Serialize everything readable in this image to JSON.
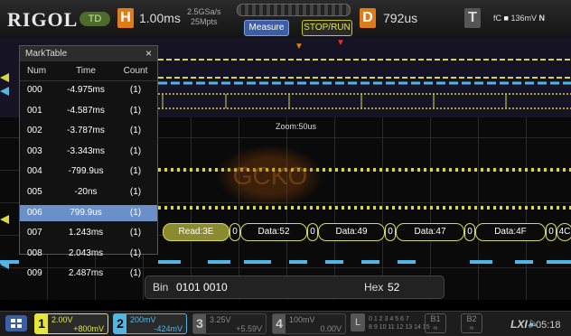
{
  "topbar": {
    "brand": "RIGOL",
    "mode": "TD",
    "horizontal": {
      "letter": "H",
      "timebase": "1.00ms",
      "rate": "2.5GSa/s",
      "depth": "25Mpts"
    },
    "buttons": {
      "measure": "Measure",
      "stoprun": "STOP/RUN"
    },
    "delay": {
      "letter": "D",
      "value": "792us"
    },
    "trigger": {
      "letter": "T",
      "source": "fC",
      "level": "136mV",
      "mode": "N"
    }
  },
  "marktable": {
    "title": "MarkTable",
    "close": "×",
    "columns": {
      "num": "Num",
      "time": "Time",
      "count": "Count"
    },
    "rows": [
      {
        "num": "000",
        "time": "-4.975ms",
        "count": "(1)"
      },
      {
        "num": "001",
        "time": "-4.587ms",
        "count": "(1)"
      },
      {
        "num": "002",
        "time": "-3.787ms",
        "count": "(1)"
      },
      {
        "num": "003",
        "time": "-3.343ms",
        "count": "(1)"
      },
      {
        "num": "004",
        "time": "-799.9us",
        "count": "(1)"
      },
      {
        "num": "005",
        "time": "-20ns",
        "count": "(1)"
      },
      {
        "num": "006",
        "time": "799.9us",
        "count": "(1)",
        "selected": true
      },
      {
        "num": "007",
        "time": "1.243ms",
        "count": "(1)"
      },
      {
        "num": "008",
        "time": "2.043ms",
        "count": "(1)"
      },
      {
        "num": "009",
        "time": "2.487ms",
        "count": "(1)"
      }
    ]
  },
  "zoom_label": "Zoom:50us",
  "decode": {
    "segments": [
      {
        "label": "Read:3E",
        "highlight": true
      },
      {
        "label": "0"
      },
      {
        "label": "Data:52"
      },
      {
        "label": "0"
      },
      {
        "label": "Data:49"
      },
      {
        "label": "0"
      },
      {
        "label": "Data:47"
      },
      {
        "label": "0"
      },
      {
        "label": "Data:4F"
      },
      {
        "label": "0"
      },
      {
        "label": "4C"
      }
    ]
  },
  "bin_hex": {
    "bin_label": "Bin",
    "bin_value": "0101 0010",
    "hex_label": "Hex",
    "hex_value": "52"
  },
  "channels": [
    {
      "num": "1",
      "scale": "2.00V",
      "offset": "+800mV",
      "color": "#e6e63a",
      "active": true
    },
    {
      "num": "2",
      "scale": "200mV",
      "offset": "-424mV",
      "color": "#4fb6e8",
      "active": true
    },
    {
      "num": "3",
      "scale": "3.25V",
      "offset": "+5.59V",
      "color": "#888888",
      "active": false
    },
    {
      "num": "4",
      "scale": "100mV",
      "offset": "0.00V",
      "color": "#888888",
      "active": false
    }
  ],
  "la": {
    "letter": "L",
    "row1": "0 1 2 3 4 5 6 7",
    "row2": "8 9 10 11 12 13 14 15"
  },
  "bus_buttons": {
    "b1": "B1",
    "b2": "B2"
  },
  "status": {
    "lxi": "LXI",
    "time": "05:18"
  },
  "colors": {
    "ch1": "#e6e63a",
    "ch2": "#4fb6e8",
    "accent": "#e07b1a",
    "selected_row": "#6b8fc9"
  },
  "watermark_text": "GCKO"
}
